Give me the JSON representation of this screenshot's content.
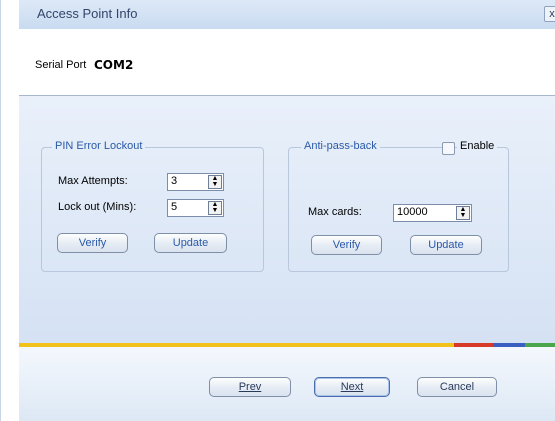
{
  "window": {
    "title": "Access Point Info",
    "close_glyph": "x"
  },
  "serial": {
    "label": "Serial Port",
    "value": "COM2"
  },
  "pin_lockout": {
    "legend": "PIN Error Lockout",
    "max_attempts_label": "Max Attempts:",
    "max_attempts_value": "3",
    "lockout_label": "Lock out (Mins):",
    "lockout_value": "5",
    "verify_label": "Verify",
    "update_label": "Update"
  },
  "anti_pass_back": {
    "legend": "Anti-pass-back",
    "enable_label": "Enable",
    "enable_checked": false,
    "max_cards_label": "Max cards:",
    "max_cards_value": "10000",
    "verify_label": "Verify",
    "update_label": "Update"
  },
  "footer": {
    "prev_label": "Prev",
    "next_label": "Next",
    "cancel_label": "Cancel"
  },
  "colors": {
    "stripe_yellow": "#f3c21a",
    "stripe_red": "#d83a2a",
    "stripe_blue": "#3a5fc0",
    "stripe_green": "#4aa64a",
    "accent_text": "#2a59a8"
  }
}
